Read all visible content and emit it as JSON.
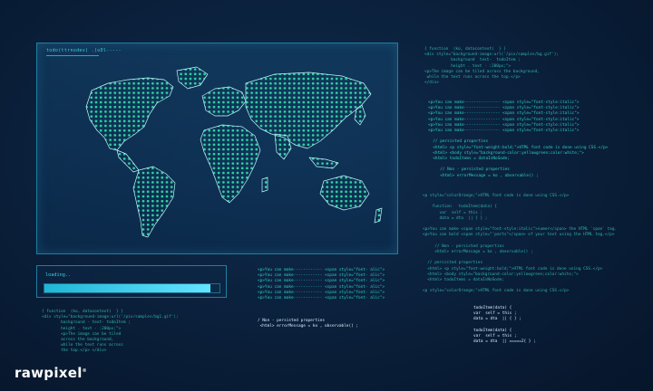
{
  "panel": {
    "title": "todo(ttrnodev) .(oDl-----",
    "loading_label": "loading..",
    "loading_progress": 0.95
  },
  "code_blocks": [
    {
      "id": "top-right",
      "lines": [
        "{ function  (ko, datacontext)  } }",
        "<div style=\"background-image:url('/pix/samples/bg.gif');",
        "           background  text-  todoItem ;",
        "           height . text - :200px;\">",
        "<p>The image can be tiled across the background,",
        " while the text runs across the top.</p>",
        "</div>"
      ]
    },
    {
      "id": "right-mid",
      "lines": [
        "<p>You can make--------------- <span style=\"font-style:italic\">",
        "<p>You can make--------------- <span style=\"font-style:italic\">",
        "<p>You can make--------------- <span style=\"font-style:italic\">",
        "<p>You can make--------------- <span style=\"font-style:italic\">",
        "<p>You can make--------------- <span style=\"font-style:italic\">",
        "<p>You can make--------------- <span style=\"font-style:italic\">",
        "",
        "  // persisted properties",
        "  <html> <p style=\"font-weight:bold;\">HTML font code is done using CSS.</p>",
        "  <html> <body style=\"background-color:yellowgreen;color:white;\">",
        "  <html> todoItems = dataIsNoSode;",
        "",
        "     // Non - persisted properties",
        "     <html> errorMessage = ko , observable() ;"
      ]
    },
    {
      "id": "right-lower",
      "lines": [
        "<p style=\"colorOrange;\">HTML font code is done using CSS.</p>",
        "",
        "    function   todoItem(data) {",
        "       var  self = this ;",
        "       data = dta  || { } ;",
        "",
        "<p>You can make <span style=\"font-style:italic\">sumer</span> the HTML `span` tag.",
        "<p>You can bold <span style=\"'parts\"</span> of your text using the HTML tag.</p>",
        "",
        "     // Non - persisted properties",
        "     <html> errorMessage = ko , observable() ;",
        "",
        "  // persisted properties",
        "  <html> <p style=\"font-weight:bold;\">HTML font code is done using CSS.</p>",
        "  <html> <body style=\"background-color:yellowgreen;color:white;\">",
        "  <html> todoItems = dataIsNoSode;",
        "",
        "<p style=\"colorOrange;\">HTML font code is done using CSS.</p>"
      ]
    },
    {
      "id": "bottom-right",
      "lines": [
        "todoItem(data) {",
        "var  self = this ;",
        "data = dta  || { } ;",
        "",
        "todoItem(data) {",
        "var  self = this ;",
        "data = dta  || =====2{ } ;"
      ]
    },
    {
      "id": "bottom-center",
      "lines": [
        "<p>You can make------------ <span style=\"font- alic\">",
        "<p>You can make------------ <span style=\"font- alic\">",
        "<p>You can make------------ <span style=\"font- alic\">",
        "<p>You can make------------ <span style=\"font- alic\">",
        "<p>You can make------------ <span style=\"font- alic\">",
        "<p>You can make------------ <span style=\"font- alic\">"
      ]
    },
    {
      "id": "bottom-center-2",
      "lines": [
        "/ Non - persisted properties",
        " <html> errorMessage = ko , observable() ;"
      ]
    },
    {
      "id": "bottom-left",
      "lines": [
        "{ function  (ko, datacontext)  } }",
        "<div style=\"background-image:url('/pix/samples/bg1.gif');",
        "        background - text- todoItem ;",
        "        height . text - :200px;\">",
        "        <p>The image can be tiled",
        "        across the background,",
        "        while the text runs across",
        "        the top.</p> </div>"
      ]
    }
  ],
  "logo": {
    "text": "rawpixel"
  },
  "colors": {
    "accent": "#2ad1c2",
    "map_dot": "#2ed3a6",
    "border": "#1f7fa0",
    "background": "#0a1f3a"
  }
}
